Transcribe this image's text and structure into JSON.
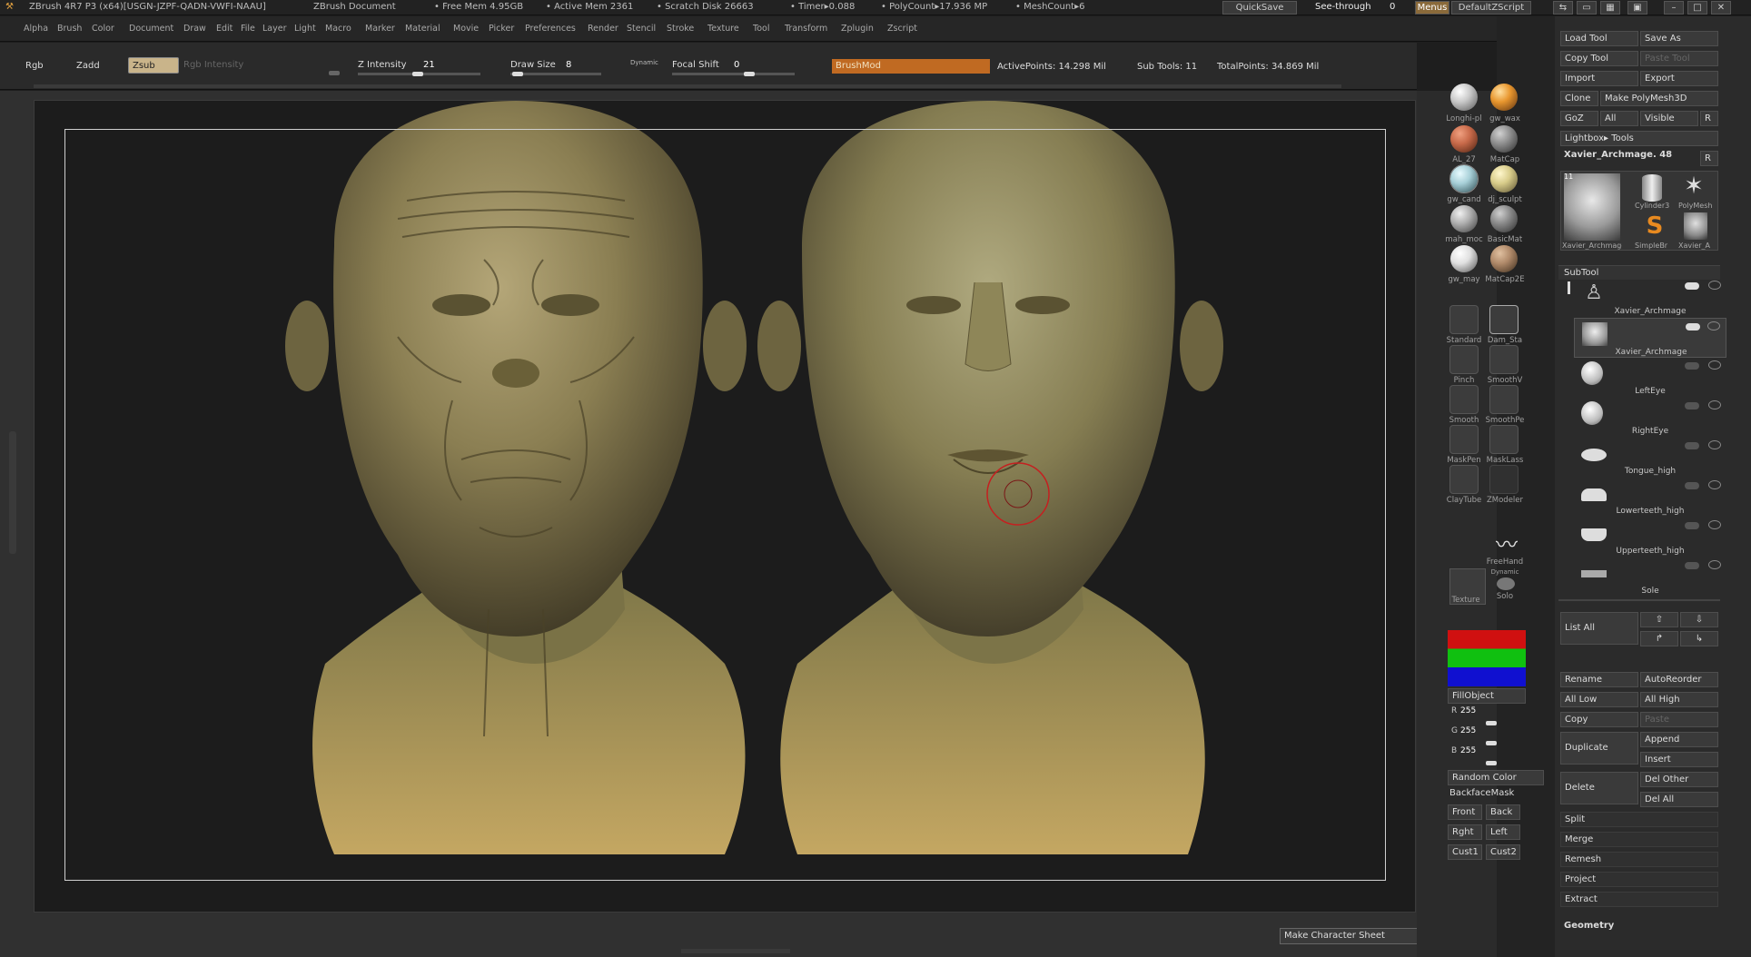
{
  "titlebar": {
    "app": "ZBrush 4R7 P3 (x64)[USGN-JZPF-QADN-VWFI-NAAU]",
    "document": "ZBrush Document",
    "free_mem": "• Free Mem 4.95GB",
    "active_mem": "• Active Mem 2361",
    "scratch": "• Scratch Disk 26663",
    "timer": "• Timer▸0.088",
    "polycount": "• PolyCount▸17.936 MP",
    "meshcount": "• MeshCount▸6",
    "quicksave": "QuickSave",
    "see_through_label": "See-through",
    "see_through_value": "0",
    "menus": "Menus",
    "script": "DefaultZScript"
  },
  "menu": [
    "Alpha",
    "Brush",
    "Color",
    "Document",
    "Draw",
    "Edit",
    "File",
    "Layer",
    "Light",
    "Macro",
    "Marker",
    "Material",
    "Movie",
    "Picker",
    "Preferences",
    "Render",
    "Stencil",
    "Stroke",
    "Texture",
    "Tool",
    "Transform",
    "Zplugin",
    "Zscript"
  ],
  "toolbar": {
    "rgb": "Rgb",
    "zadd": "Zadd",
    "zsub": "Zsub",
    "rgb_intensity": "Rgb Intensity",
    "z_intensity_label": "Z Intensity",
    "z_intensity": "21",
    "draw_size_label": "Draw Size",
    "draw_size": "8",
    "dynamic": "Dynamic",
    "focal_label": "Focal Shift",
    "focal": "0",
    "brushmod": "BrushMod",
    "active_points": "ActivePoints: 14.298 Mil",
    "sub_tools": "Sub Tools: 11",
    "total_points": "TotalPoints: 34.869 Mil"
  },
  "viewport": {
    "make_sheet": "Make Character Sheet",
    "accent": "#c87a2a"
  },
  "materials": [
    {
      "name": "Longhi-pl",
      "color": "#c9c9c9"
    },
    {
      "name": "gw_wax",
      "color": "#e8962e"
    },
    {
      "name": "AL_27",
      "color": "#c86a4a"
    },
    {
      "name": "MatCap",
      "color": "#8f8f8f"
    },
    {
      "name": "gw_cand",
      "color": "#a8d0d8"
    },
    {
      "name": "dj_sculpt",
      "color": "#d8cc8a"
    },
    {
      "name": "mah_moc",
      "color": "#b0b0b0"
    },
    {
      "name": "BasicMat",
      "color": "#8a8a8a"
    },
    {
      "name": "gw_may",
      "color": "#e0e0e0"
    },
    {
      "name": "MatCap2E",
      "color": "#b08a6a"
    }
  ],
  "brushes": [
    "Standard",
    "Dam_Sta",
    "Pinch",
    "SmoothV",
    "Smooth",
    "SmoothPe",
    "MaskPen",
    "MaskLass",
    "ClayTube",
    "ZModeler"
  ],
  "stroke": "FreeHand",
  "texture": "Texture",
  "dynamic_solo": "Dynamic",
  "solo": "Solo",
  "color": {
    "fill_object": "FillObject",
    "r_label": "R",
    "r": "255",
    "g_label": "G",
    "g": "255",
    "b_label": "B",
    "b": "255",
    "random": "Random Color",
    "backface": "BackfaceMask",
    "front": "Front",
    "back": "Back",
    "right": "Rght",
    "left": "Left",
    "cust1": "Cust1",
    "cust2": "Cust2"
  },
  "tool": {
    "load": "Load Tool",
    "save_as": "Save As",
    "copy": "Copy Tool",
    "paste": "Paste Tool",
    "import": "Import",
    "export": "Export",
    "clone": "Clone",
    "make_polymesh": "Make PolyMesh3D",
    "goz": "GoZ",
    "all": "All",
    "visible": "Visible",
    "r": "R",
    "lightbox": "Lightbox▸ Tools",
    "current": "Xavier_Archmage. 48",
    "thumbs": [
      "Xavier_Archmage",
      "Cylinder3",
      "PolyMesh",
      "SimpleBr",
      "Xavier_A"
    ],
    "thumb_count": "11"
  },
  "subtool": {
    "header": "SubTool",
    "items": [
      "Xavier_Archmage",
      "Xavier_Archmage",
      "LeftEye",
      "RightEye",
      "Tongue_high",
      "Lowerteeth_high",
      "Upperteeth_high",
      "Sole"
    ],
    "list_all": "List All",
    "rename": "Rename",
    "autoreorder": "AutoReorder",
    "all_low": "All Low",
    "all_high": "All High",
    "copy": "Copy",
    "paste": "Paste",
    "duplicate": "Duplicate",
    "append": "Append",
    "insert": "Insert",
    "delete": "Delete",
    "del_other": "Del Other",
    "del_all": "Del All",
    "split": "Split",
    "merge": "Merge",
    "remesh": "Remesh",
    "project": "Project",
    "extract": "Extract",
    "geometry": "Geometry"
  }
}
